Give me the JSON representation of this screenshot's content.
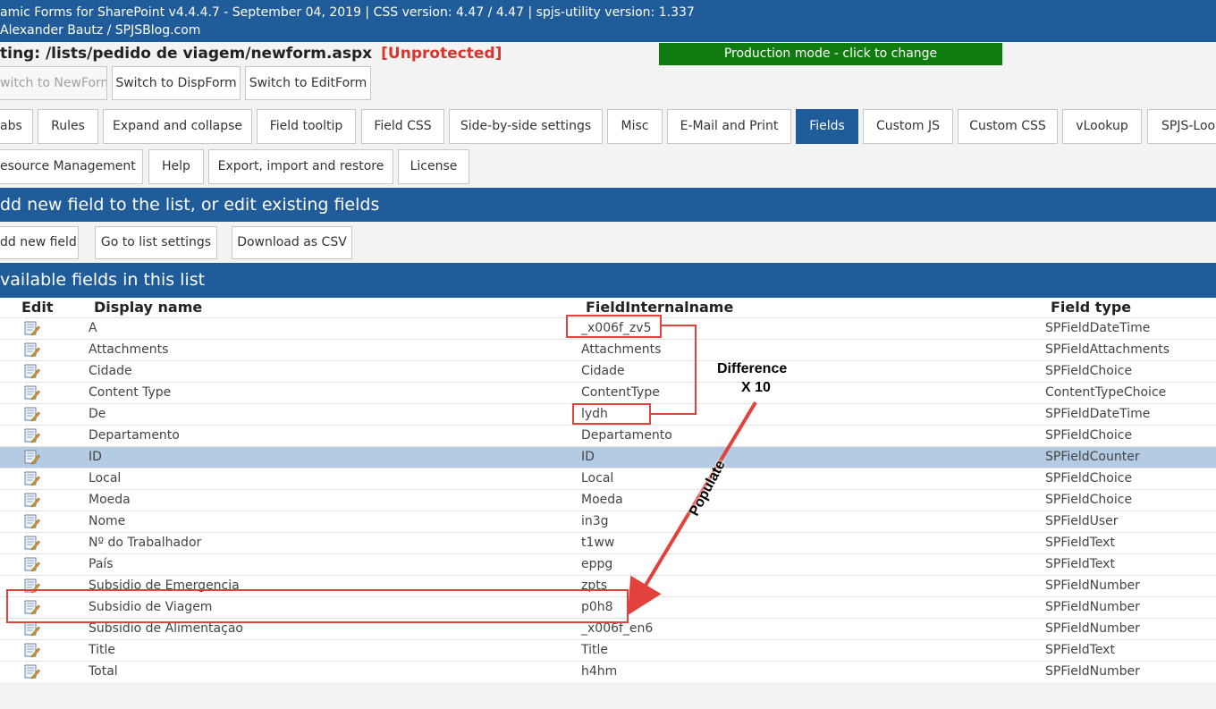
{
  "header": {
    "line1": "amic Forms for SharePoint v4.4.4.7 - September 04, 2019 | CSS version: 4.47 / 4.47 | spjs-utility version: 1.337",
    "line2": " Alexander Bautz / SPJSBlog.com"
  },
  "editing": {
    "label": "ting: /lists/pedido de viagem/newform.aspx",
    "status": "[Unprotected]"
  },
  "production_mode": "Production mode - click to change",
  "switch_buttons": [
    "witch to NewForm",
    "Switch to DispForm",
    "Switch to EditForm"
  ],
  "tabs_row1": [
    "abs",
    "Rules",
    "Expand and collapse",
    "Field tooltip",
    "Field CSS",
    "Side-by-side settings",
    "Misc",
    "E-Mail and Print",
    "Fields",
    "Custom JS",
    "Custom CSS",
    "vLookup",
    "SPJS-Look"
  ],
  "tabs_row2": [
    "esource Management",
    "Help",
    "Export, import and restore",
    "License"
  ],
  "section_add": "dd new field to the list, or edit existing fields",
  "action_buttons": [
    "dd new field",
    "Go to list settings",
    "Download as CSV"
  ],
  "section_available": "vailable fields in this list",
  "table": {
    "headers": {
      "edit": "Edit",
      "display": "Display name",
      "internal": "FieldInternalname",
      "type": "Field type"
    },
    "rows": [
      {
        "display": "A",
        "internal": "_x006f_zv5",
        "type": "SPFieldDateTime"
      },
      {
        "display": "Attachments",
        "internal": "Attachments",
        "type": "SPFieldAttachments"
      },
      {
        "display": "Cidade",
        "internal": "Cidade",
        "type": "SPFieldChoice"
      },
      {
        "display": "Content Type",
        "internal": "ContentType",
        "type": "ContentTypeChoice"
      },
      {
        "display": "De",
        "internal": "lydh",
        "type": "SPFieldDateTime"
      },
      {
        "display": "Departamento",
        "internal": "Departamento",
        "type": "SPFieldChoice"
      },
      {
        "display": "ID",
        "internal": "ID",
        "type": "SPFieldCounter"
      },
      {
        "display": "Local",
        "internal": "Local",
        "type": "SPFieldChoice"
      },
      {
        "display": "Moeda",
        "internal": "Moeda",
        "type": "SPFieldChoice"
      },
      {
        "display": "Nome",
        "internal": "in3g",
        "type": "SPFieldUser"
      },
      {
        "display": "Nº do Trabalhador",
        "internal": "t1ww",
        "type": "SPFieldText"
      },
      {
        "display": "País",
        "internal": "eppg",
        "type": "SPFieldText"
      },
      {
        "display": "Subsidio de Emergencia",
        "internal": "zpts",
        "type": "SPFieldNumber"
      },
      {
        "display": "Subsidio de Viagem",
        "internal": "p0h8",
        "type": "SPFieldNumber"
      },
      {
        "display": "Subsidio de Alimentação",
        "internal": "_x006f_en6",
        "type": "SPFieldNumber"
      },
      {
        "display": "Title",
        "internal": "Title",
        "type": "SPFieldText"
      },
      {
        "display": "Total",
        "internal": "h4hm",
        "type": "SPFieldNumber"
      }
    ]
  },
  "annotations": {
    "difference_line1": "Difference",
    "difference_line2": "X 10",
    "populate": "Populate"
  },
  "colors": {
    "header_blue": "#1f5c99",
    "production_green": "#107c10",
    "unprotected_red": "#d9342b",
    "annotation_red": "#e3423c",
    "selected_row": "#b3cce4"
  },
  "icons": {
    "edit_icon": "edit-pencil-document-icon"
  }
}
